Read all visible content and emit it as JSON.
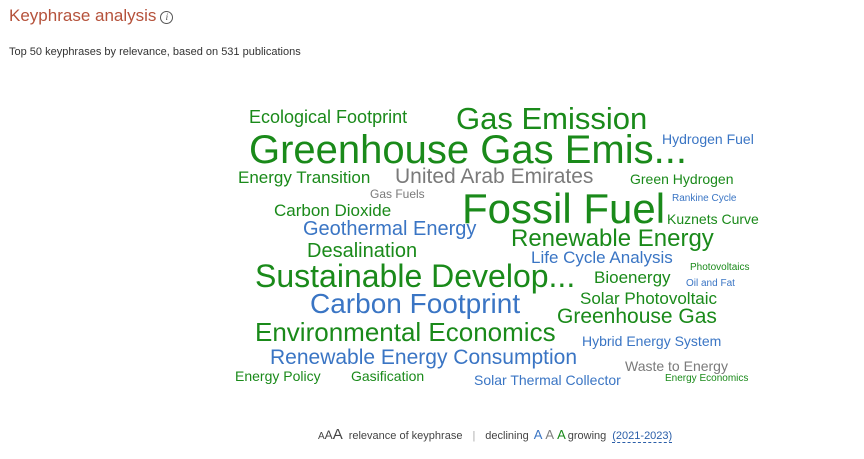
{
  "header": {
    "title": "Keyphrase analysis",
    "info_icon": "info-icon",
    "subtitle": "Top 50 keyphrases by relevance, based on 531 publications"
  },
  "colors": {
    "green": "#1a8a1a",
    "blue": "#3a75c4",
    "gray": "#7a7a7a"
  },
  "keyphrases": [
    {
      "text": "Ecological Footprint",
      "trend": "green"
    },
    {
      "text": "Gas Emission",
      "trend": "green"
    },
    {
      "text": "Hydrogen Fuel",
      "trend": "blue"
    },
    {
      "text": "Greenhouse Gas Emis...",
      "trend": "green"
    },
    {
      "text": "Energy Transition",
      "trend": "green"
    },
    {
      "text": "United Arab Emirates",
      "trend": "gray"
    },
    {
      "text": "Green Hydrogen",
      "trend": "green"
    },
    {
      "text": "Gas Fuels",
      "trend": "gray"
    },
    {
      "text": "Rankine Cycle",
      "trend": "blue"
    },
    {
      "text": "Carbon Dioxide",
      "trend": "green"
    },
    {
      "text": "Fossil Fuel",
      "trend": "green"
    },
    {
      "text": "Kuznets Curve",
      "trend": "green"
    },
    {
      "text": "Geothermal Energy",
      "trend": "blue"
    },
    {
      "text": "Renewable Energy",
      "trend": "green"
    },
    {
      "text": "Desalination",
      "trend": "green"
    },
    {
      "text": "Life Cycle Analysis",
      "trend": "blue"
    },
    {
      "text": "Sustainable Develop...",
      "trend": "green"
    },
    {
      "text": "Bioenergy",
      "trend": "green"
    },
    {
      "text": "Photovoltaics",
      "trend": "green"
    },
    {
      "text": "Oil and Fat",
      "trend": "blue"
    },
    {
      "text": "Carbon Footprint",
      "trend": "blue"
    },
    {
      "text": "Solar Photovoltaic",
      "trend": "green"
    },
    {
      "text": "Greenhouse Gas",
      "trend": "green"
    },
    {
      "text": "Environmental Economics",
      "trend": "green"
    },
    {
      "text": "Hybrid Energy System",
      "trend": "blue"
    },
    {
      "text": "Renewable Energy Consumption",
      "trend": "blue"
    },
    {
      "text": "Waste to Energy",
      "trend": "gray"
    },
    {
      "text": "Energy Policy",
      "trend": "green"
    },
    {
      "text": "Gasification",
      "trend": "green"
    },
    {
      "text": "Solar Thermal Collector",
      "trend": "blue"
    },
    {
      "text": "Energy Economics",
      "trend": "green"
    }
  ],
  "legend": {
    "size_glyphs": [
      "A",
      "A",
      "A"
    ],
    "relevance_label": "relevance of keyphrase",
    "separator": "|",
    "declining_label": "declining",
    "trend_glyphs": [
      "A",
      "A",
      "A"
    ],
    "growing_label": "growing",
    "period": "(2021-2023)"
  }
}
